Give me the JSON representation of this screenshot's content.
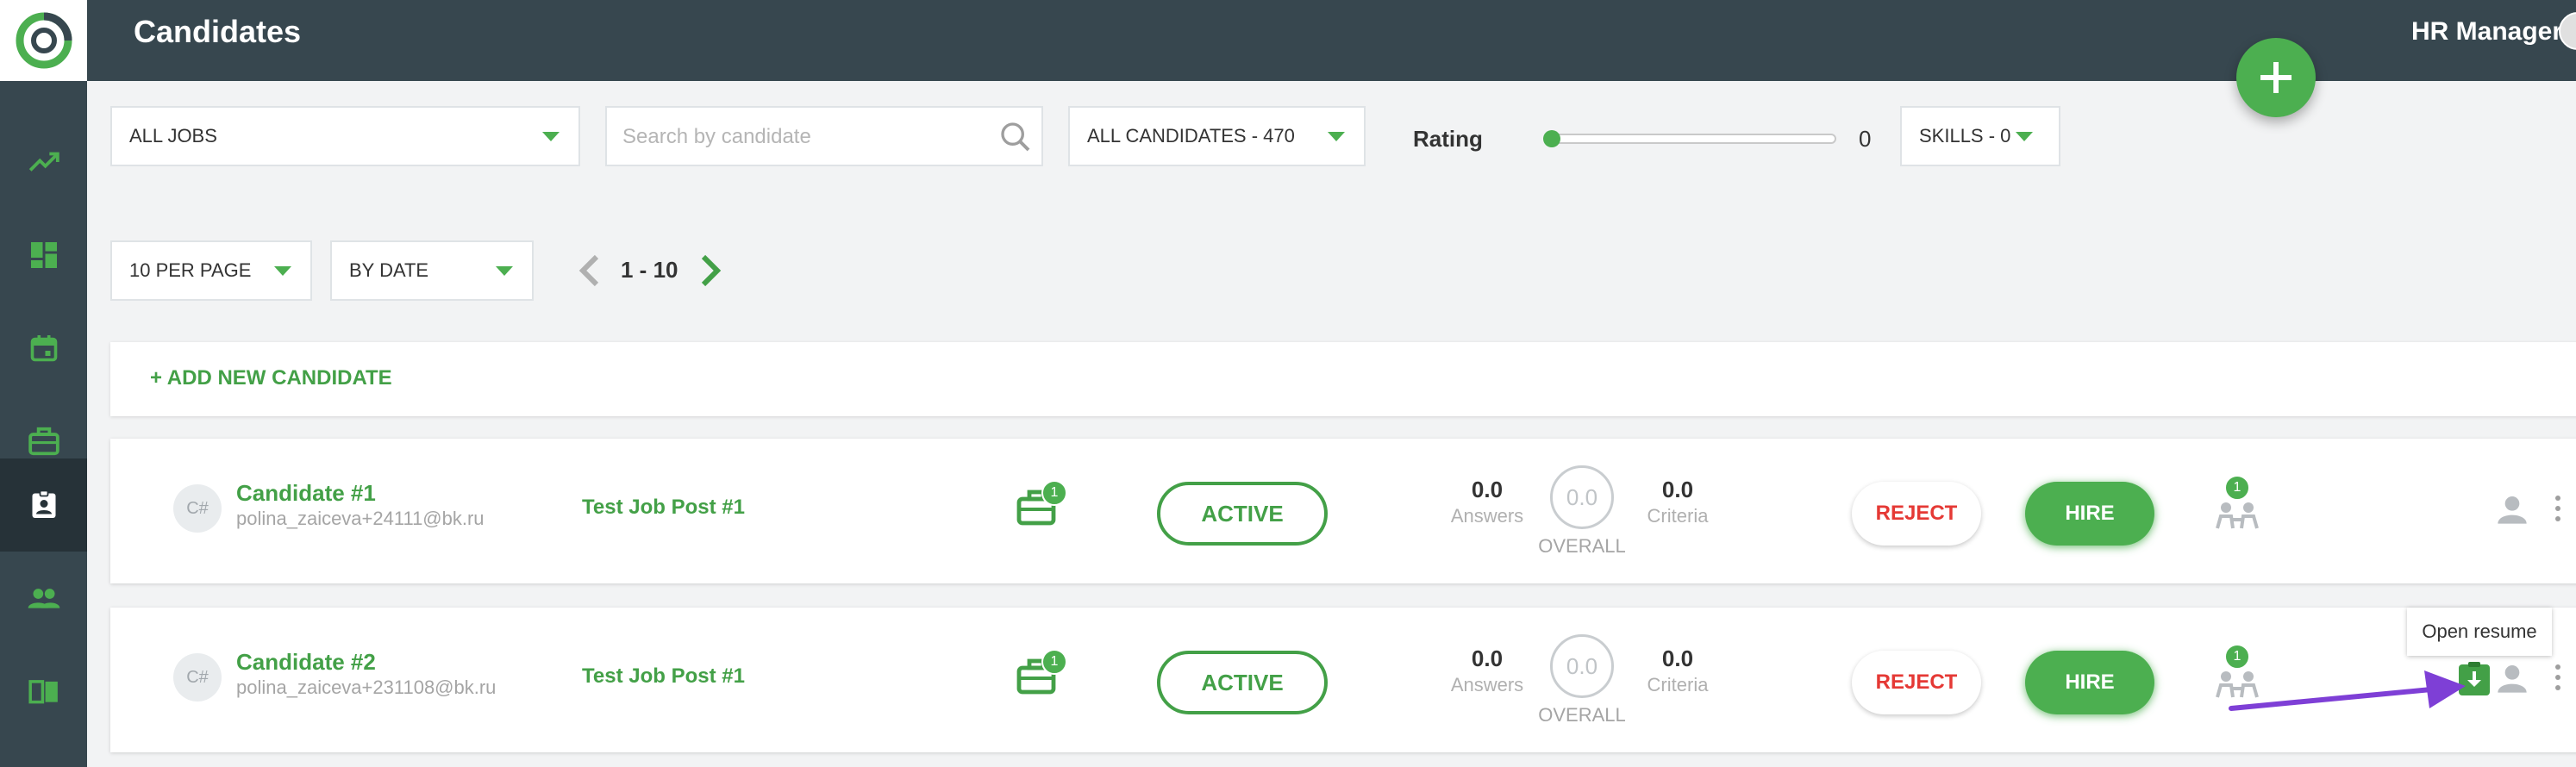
{
  "header": {
    "title": "Candidates",
    "user_name": "HR Manager"
  },
  "sidebar": {
    "items": [
      {
        "name": "analytics"
      },
      {
        "name": "dashboard"
      },
      {
        "name": "calendar"
      },
      {
        "name": "jobs"
      },
      {
        "name": "candidates",
        "active": true
      },
      {
        "name": "team"
      },
      {
        "name": "knowledge-base"
      }
    ]
  },
  "filters": {
    "jobs_label": "ALL JOBS",
    "search_placeholder": "Search by candidate",
    "search_value": "",
    "candidates_label": "ALL CANDIDATES - 470",
    "rating_label": "Rating",
    "rating_value": "0",
    "skills_label": "SKILLS - 0"
  },
  "paging": {
    "per_page_label": "10 PER PAGE",
    "sort_label": "BY DATE",
    "range_label": "1 - 10"
  },
  "add_candidate_label": "+ ADD NEW CANDIDATE",
  "candidates": [
    {
      "initials": "C#",
      "name": "Candidate #1",
      "email": "polina_zaiceva+24111@bk.ru",
      "job": "Test Job Post #1",
      "job_badge": "1",
      "status": "ACTIVE",
      "answers_value": "0.0",
      "answers_label": "Answers",
      "overall_value": "0.0",
      "overall_label": "OVERALL",
      "criteria_value": "0.0",
      "criteria_label": "Criteria",
      "reject_label": "REJECT",
      "hire_label": "HIRE",
      "interview_badge": "1"
    },
    {
      "initials": "C#",
      "name": "Candidate #2",
      "email": "polina_zaiceva+231108@bk.ru",
      "job": "Test Job Post #1",
      "job_badge": "1",
      "status": "ACTIVE",
      "answers_value": "0.0",
      "answers_label": "Answers",
      "overall_value": "0.0",
      "overall_label": "OVERALL",
      "criteria_value": "0.0",
      "criteria_label": "Criteria",
      "reject_label": "REJECT",
      "hire_label": "HIRE",
      "interview_badge": "1"
    }
  ],
  "tooltip": {
    "text": "Open resume"
  },
  "colors": {
    "topbar": "#37474f",
    "accent": "#4caf50",
    "reject": "#e53935",
    "annotation_arrow": "#7e3fd6"
  }
}
